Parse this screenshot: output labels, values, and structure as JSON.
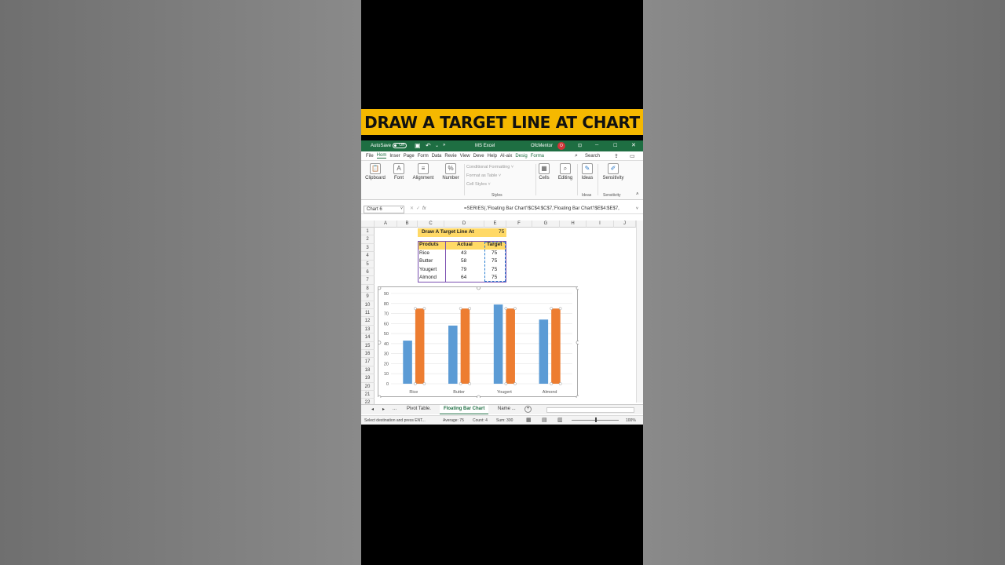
{
  "banner": {
    "title": "DRAW A TARGET LINE AT CHART"
  },
  "titlebar": {
    "autosave": "AutoSave",
    "toggle": "Off",
    "app": "MS Excel",
    "user": "OfcMentor",
    "avatar": "O",
    "more": "»",
    "dropdown": "⌄"
  },
  "menu": {
    "items": [
      "File",
      "Hom",
      "Inser",
      "Page",
      "Form",
      "Data",
      "Revie",
      "View",
      "Deve",
      "Help",
      "AI-aix",
      "Desig",
      "Forma"
    ],
    "search": "Search"
  },
  "ribbon": {
    "groups": [
      {
        "label": "Clipboard",
        "icon": "clipboard-icon",
        "glyph": "📋"
      },
      {
        "label": "Font",
        "icon": "font-icon",
        "glyph": "A"
      },
      {
        "label": "Alignment",
        "icon": "alignment-icon",
        "glyph": "≡"
      },
      {
        "label": "Number",
        "icon": "number-icon",
        "glyph": "%"
      },
      {
        "label": "Cells",
        "icon": "cells-icon",
        "glyph": "▦"
      },
      {
        "label": "Editing",
        "icon": "editing-icon",
        "glyph": "⌕"
      },
      {
        "label": "Ideas",
        "icon": "ideas-icon",
        "glyph": "✎"
      },
      {
        "label": "Sensitivity",
        "icon": "sensitivity-icon",
        "glyph": "✐"
      }
    ],
    "styles_items": [
      "Conditional Formatting ˅",
      "Format as Table ˅",
      "Cell Styles ˅"
    ],
    "styles_label": "Styles",
    "ideas_label": "Ideas",
    "sensitivity_label": "Sensitivity"
  },
  "formula_bar": {
    "namebox": "Chart 6",
    "fx": "fx",
    "formula": "=SERIES(,'Floating Bar Chart'!$C$4:$C$7,'Floating Bar Chart'!$E$4:$E$7,"
  },
  "grid": {
    "columns": [
      "A",
      "B",
      "C",
      "D",
      "E",
      "F",
      "G",
      "H",
      "I",
      "J"
    ],
    "rows": [
      "1",
      "2",
      "3",
      "4",
      "5",
      "6",
      "7",
      "8",
      "9",
      "10",
      "11",
      "12",
      "13",
      "14",
      "15",
      "16",
      "17",
      "18",
      "19",
      "20",
      "21",
      "22"
    ],
    "title_cell": "Draw A Target Line At",
    "title_value": "75",
    "table": {
      "headers": [
        "Produts",
        "Actual",
        "Target"
      ],
      "rows": [
        [
          "Rice",
          "43",
          "75"
        ],
        [
          "Butter",
          "58",
          "75"
        ],
        [
          "Yougert",
          "79",
          "75"
        ],
        [
          "Almond",
          "64",
          "75"
        ]
      ]
    }
  },
  "chart_data": {
    "type": "bar",
    "categories": [
      "Rice",
      "Butter",
      "Yougert",
      "Almond"
    ],
    "series": [
      {
        "values": [
          43,
          58,
          79,
          64
        ],
        "color": "#5b9bd5"
      },
      {
        "values": [
          75,
          75,
          75,
          75
        ],
        "color": "#ed7d31"
      }
    ],
    "ylim": [
      0,
      90
    ],
    "yticks": [
      0,
      10,
      20,
      30,
      40,
      50,
      60,
      70,
      80,
      90
    ],
    "grid": true
  },
  "sheet_tabs": {
    "nav_prev": "◂",
    "nav_next": "▸",
    "more": "...",
    "tabs": [
      "Pivot Table.",
      "Floating Bar Chart",
      "Name ..."
    ],
    "add": "+"
  },
  "status": {
    "message": "Select destination and press ENT...",
    "average": "Average: 75",
    "count": "Count: 4",
    "sum": "Sum: 300",
    "zoom": "100%"
  },
  "colors": {
    "excel_green": "#1e6e42",
    "banner": "#f5b800",
    "header_fill": "#ffd966"
  }
}
